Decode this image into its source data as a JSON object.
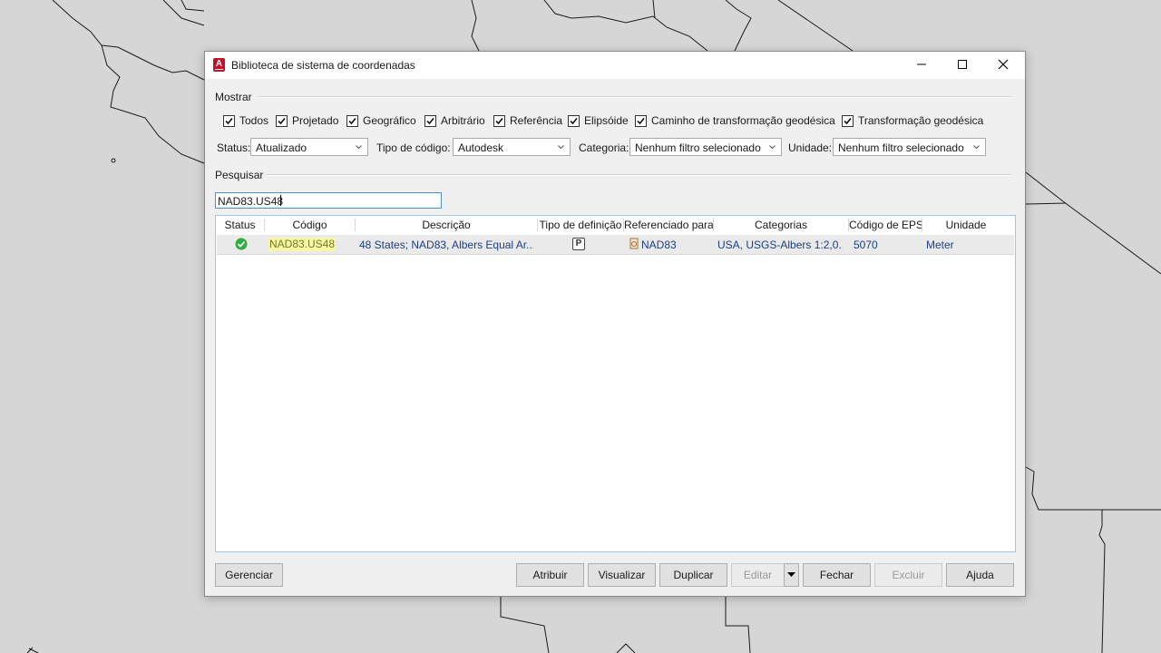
{
  "window": {
    "title": "Biblioteca de sistema de coordenadas"
  },
  "show_section": {
    "label": "Mostrar"
  },
  "filters": [
    {
      "label": "Todos",
      "checked": true
    },
    {
      "label": "Projetado",
      "checked": true
    },
    {
      "label": "Geográfico",
      "checked": true
    },
    {
      "label": "Arbitrário",
      "checked": true
    },
    {
      "label": "Referência",
      "checked": true
    },
    {
      "label": "Elipsóide",
      "checked": true
    },
    {
      "label": "Caminho de transformação geodésica",
      "checked": true
    },
    {
      "label": "Transformação geodésica",
      "checked": true
    }
  ],
  "dropdowns": {
    "status": {
      "label": "Status:",
      "value": "Atualizado"
    },
    "code_type": {
      "label": "Tipo de código:",
      "value": "Autodesk"
    },
    "category": {
      "label": "Categoria:",
      "value": "Nenhum filtro selecionado"
    },
    "unit": {
      "label": "Unidade:",
      "value": "Nenhum filtro selecionado"
    }
  },
  "search": {
    "label": "Pesquisar",
    "value": "NAD83.US48"
  },
  "table": {
    "columns": [
      "Status",
      "Código",
      "Descrição",
      "Tipo de definição",
      "Referenciado para",
      "Categorias",
      "Código de EPS",
      "Unidade"
    ],
    "rows": [
      {
        "status": "ok",
        "code": "NAD83.US48",
        "description": "48 States; NAD83, Albers Equal Ar...",
        "definition_type": "P",
        "referenced_to": "NAD83",
        "categories": "USA, USGS-Albers 1:2,0...",
        "epsg": "5070",
        "unit": "Meter"
      }
    ]
  },
  "buttons": {
    "manage": "Gerenciar",
    "assign": "Atribuir",
    "view": "Visualizar",
    "duplicate": "Duplicar",
    "edit": "Editar",
    "close": "Fechar",
    "delete": "Excluir",
    "help": "Ajuda"
  },
  "colors": {
    "highlight": "#f7f7a8",
    "accent": "#1b3f8b",
    "status_ok": "#2eae3a",
    "brand": "#c8102e"
  }
}
